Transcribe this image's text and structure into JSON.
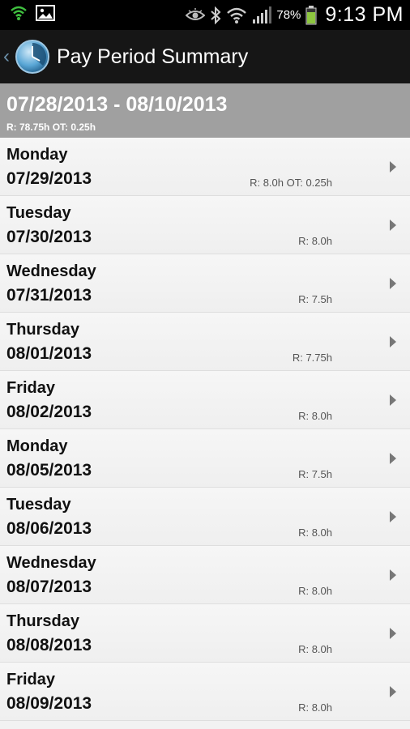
{
  "status_bar": {
    "battery_percent": "78%",
    "time": "9:13 PM"
  },
  "action_bar": {
    "title": "Pay Period Summary",
    "icon": "clock-icon"
  },
  "period": {
    "range": "07/28/2013 - 08/10/2013",
    "summary": "R: 78.75h  OT: 0.25h"
  },
  "days": [
    {
      "name": "Monday",
      "date": "07/29/2013",
      "hours": "R: 8.0h OT: 0.25h"
    },
    {
      "name": "Tuesday",
      "date": "07/30/2013",
      "hours": "R: 8.0h"
    },
    {
      "name": "Wednesday",
      "date": "07/31/2013",
      "hours": "R: 7.5h"
    },
    {
      "name": "Thursday",
      "date": "08/01/2013",
      "hours": "R: 7.75h"
    },
    {
      "name": "Friday",
      "date": "08/02/2013",
      "hours": "R: 8.0h"
    },
    {
      "name": "Monday",
      "date": "08/05/2013",
      "hours": "R: 7.5h"
    },
    {
      "name": "Tuesday",
      "date": "08/06/2013",
      "hours": "R: 8.0h"
    },
    {
      "name": "Wednesday",
      "date": "08/07/2013",
      "hours": "R: 8.0h"
    },
    {
      "name": "Thursday",
      "date": "08/08/2013",
      "hours": "R: 8.0h"
    },
    {
      "name": "Friday",
      "date": "08/09/2013",
      "hours": "R: 8.0h"
    }
  ]
}
